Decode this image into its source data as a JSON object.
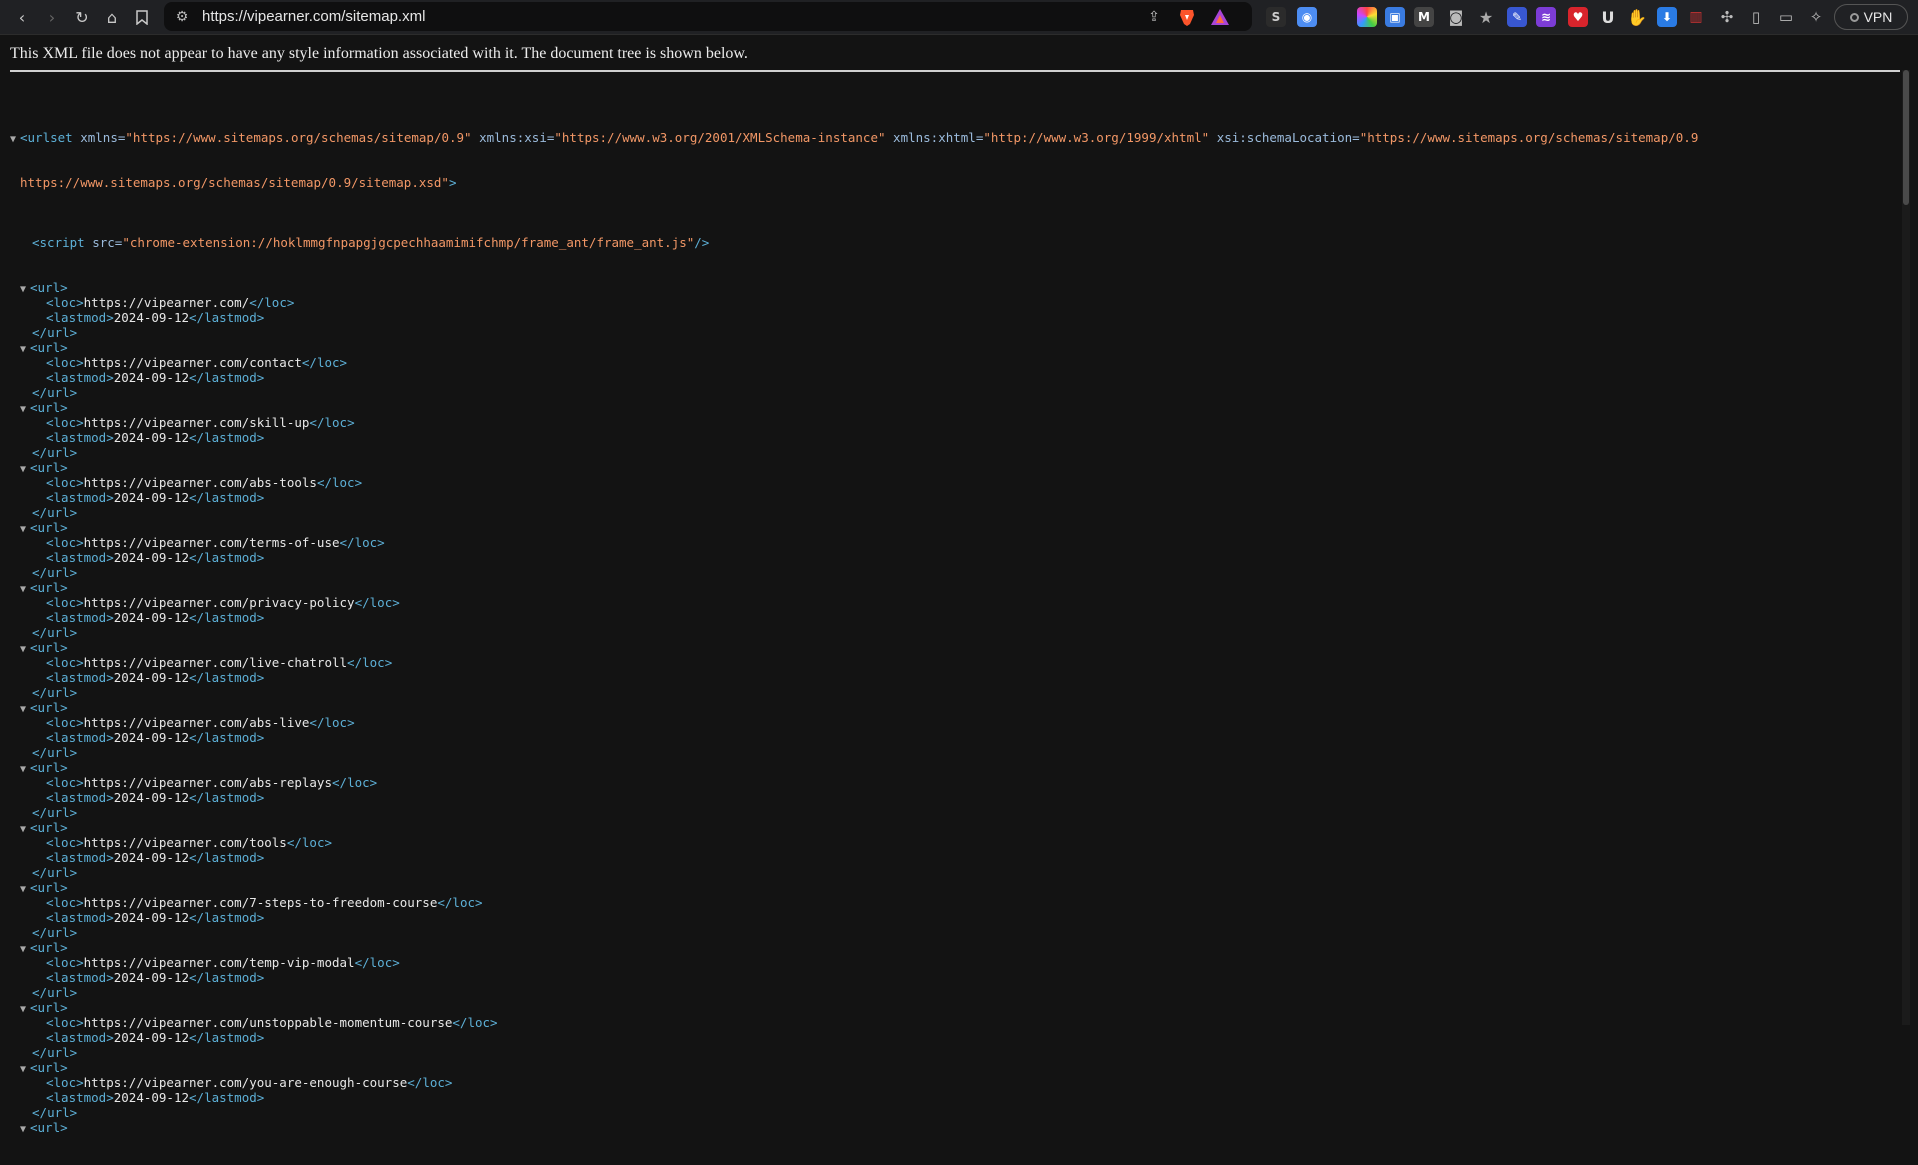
{
  "browser": {
    "url": "https://vipearner.com/sitemap.xml",
    "vpn_label": "VPN"
  },
  "notice": "This XML file does not appear to have any style information associated with it. The document tree is shown below.",
  "xml": {
    "root_open_line1": {
      "tag": "urlset",
      "attrs": [
        {
          "name": "xmlns",
          "value": "\"https://www.sitemaps.org/schemas/sitemap/0.9\""
        },
        {
          "name": "xmlns:xsi",
          "value": "\"https://www.w3.org/2001/XMLSchema-instance\""
        },
        {
          "name": "xmlns:xhtml",
          "value": "\"http://www.w3.org/1999/xhtml\""
        },
        {
          "name": "xsi:schemaLocation",
          "value": "\"https://www.sitemaps.org/schemas/sitemap/0.9"
        }
      ],
      "continuation": "https://www.sitemaps.org/schemas/sitemap/0.9/sitemap.xsd\""
    },
    "script_src": "\"chrome-extension://hoklmmgfnpapgjgcpechhaamimifchmp/frame_ant/frame_ant.js\"",
    "urls": [
      {
        "loc": "https://vipearner.com/",
        "lastmod": "2024-09-12"
      },
      {
        "loc": "https://vipearner.com/contact",
        "lastmod": "2024-09-12"
      },
      {
        "loc": "https://vipearner.com/skill-up",
        "lastmod": "2024-09-12"
      },
      {
        "loc": "https://vipearner.com/abs-tools",
        "lastmod": "2024-09-12"
      },
      {
        "loc": "https://vipearner.com/terms-of-use",
        "lastmod": "2024-09-12"
      },
      {
        "loc": "https://vipearner.com/privacy-policy",
        "lastmod": "2024-09-12"
      },
      {
        "loc": "https://vipearner.com/live-chatroll",
        "lastmod": "2024-09-12"
      },
      {
        "loc": "https://vipearner.com/abs-live",
        "lastmod": "2024-09-12"
      },
      {
        "loc": "https://vipearner.com/abs-replays",
        "lastmod": "2024-09-12"
      },
      {
        "loc": "https://vipearner.com/tools",
        "lastmod": "2024-09-12"
      },
      {
        "loc": "https://vipearner.com/7-steps-to-freedom-course",
        "lastmod": "2024-09-12"
      },
      {
        "loc": "https://vipearner.com/temp-vip-modal",
        "lastmod": "2024-09-12"
      },
      {
        "loc": "https://vipearner.com/unstoppable-momentum-course",
        "lastmod": "2024-09-12"
      },
      {
        "loc": "https://vipearner.com/you-are-enough-course",
        "lastmod": "2024-09-12"
      }
    ],
    "tags": {
      "url": "url",
      "loc": "loc",
      "lastmod": "lastmod",
      "script": "script",
      "src_attr": "src"
    }
  }
}
